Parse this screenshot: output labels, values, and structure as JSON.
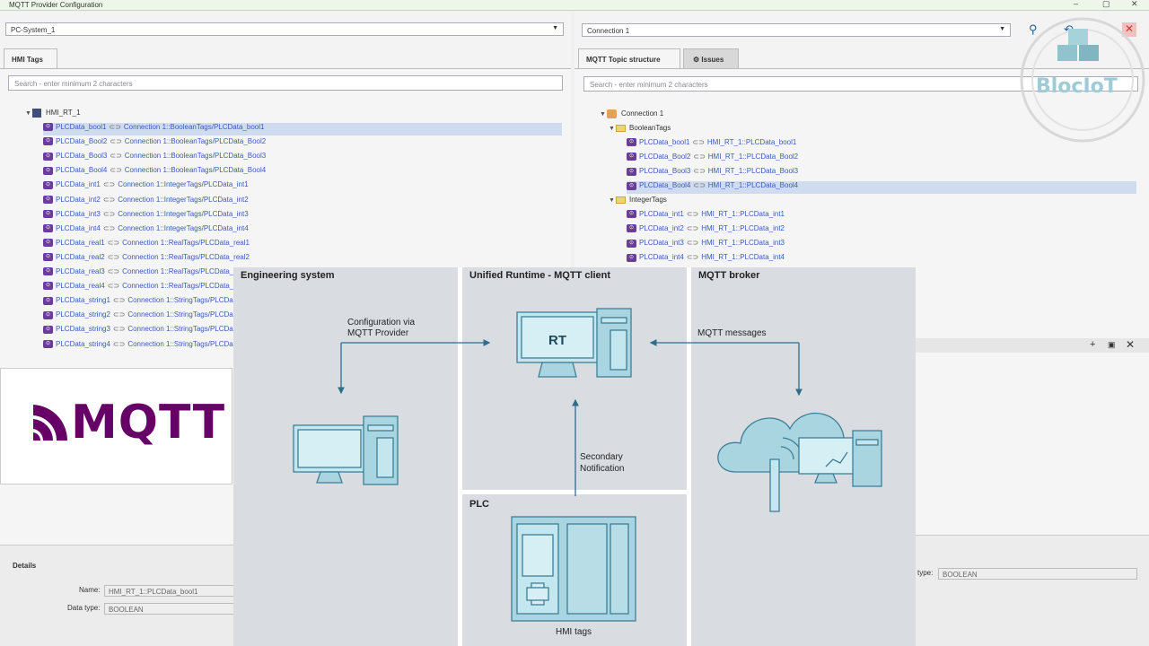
{
  "window": {
    "title": "MQTT Provider Configuration",
    "controls": [
      "–",
      "▢",
      "✕"
    ]
  },
  "left": {
    "system_select": "PC-System_1",
    "tab": "HMI Tags",
    "search_placeholder": "Search - enter minimum 2 characters",
    "root": "HMI_RT_1",
    "rows": [
      {
        "tag": "PLCData_bool1",
        "map": "Connection 1::BooleanTags/PLCData_bool1"
      },
      {
        "tag": "PLCData_Bool2",
        "map": "Connection 1::BooleanTags/PLCData_Bool2"
      },
      {
        "tag": "PLCData_Bool3",
        "map": "Connection 1::BooleanTags/PLCData_Bool3"
      },
      {
        "tag": "PLCData_Bool4",
        "map": "Connection 1::BooleanTags/PLCData_Bool4"
      },
      {
        "tag": "PLCData_int1",
        "map": "Connection 1::IntegerTags/PLCData_int1"
      },
      {
        "tag": "PLCData_int2",
        "map": "Connection 1::IntegerTags/PLCData_int2"
      },
      {
        "tag": "PLCData_int3",
        "map": "Connection 1::IntegerTags/PLCData_int3"
      },
      {
        "tag": "PLCData_int4",
        "map": "Connection 1::IntegerTags/PLCData_int4"
      },
      {
        "tag": "PLCData_real1",
        "map": "Connection 1::RealTags/PLCData_real1"
      },
      {
        "tag": "PLCData_real2",
        "map": "Connection 1::RealTags/PLCData_real2"
      },
      {
        "tag": "PLCData_real3",
        "map": "Connection 1::RealTags/PLCData_re"
      },
      {
        "tag": "PLCData_real4",
        "map": "Connection 1::RealTags/PLCData_re"
      },
      {
        "tag": "PLCData_string1",
        "map": "Connection 1::StringTags/PLCDa"
      },
      {
        "tag": "PLCData_string2",
        "map": "Connection 1::StringTags/PLCDa"
      },
      {
        "tag": "PLCData_string3",
        "map": "Connection 1::StringTags/PLCDa"
      },
      {
        "tag": "PLCData_string4",
        "map": "Connection 1::StringTags/PLCDa"
      }
    ],
    "details": {
      "heading": "Details",
      "name_label": "Name:",
      "name_value": "HMI_RT_1::PLCData_bool1",
      "type_label": "Data type:",
      "type_value": "BOOLEAN"
    }
  },
  "right": {
    "connection_select": "Connection 1",
    "tab_active": "MQTT Topic structure",
    "tab_inactive": "Issues",
    "search_placeholder": "Search - enter minimum 2 characters",
    "root": "Connection 1",
    "folder_bool": "BooleanTags",
    "folder_int": "IntegerTags",
    "bool_rows": [
      {
        "tag": "PLCData_bool1",
        "map": "HMI_RT_1::PLCData_bool1"
      },
      {
        "tag": "PLCData_Bool2",
        "map": "HMI_RT_1::PLCData_Bool2"
      },
      {
        "tag": "PLCData_Bool3",
        "map": "HMI_RT_1::PLCData_Bool3"
      },
      {
        "tag": "PLCData_Bool4",
        "map": "HMI_RT_1::PLCData_Bool4"
      }
    ],
    "int_rows": [
      {
        "tag": "PLCData_int1",
        "map": "HMI_RT_1::PLCData_int1"
      },
      {
        "tag": "PLCData_int2",
        "map": "HMI_RT_1::PLCData_int2"
      },
      {
        "tag": "PLCData_int3",
        "map": "HMI_RT_1::PLCData_int3"
      },
      {
        "tag": "PLCData_int4",
        "map": "HMI_RT_1::PLCData_int4"
      }
    ],
    "details_type_label": "type:",
    "details_type_value": "BOOLEAN"
  },
  "logo": {
    "text": "MQTT",
    "color": "#660066"
  },
  "watermark": {
    "text": "BlocIoT"
  },
  "diagram": {
    "engineering_title": "Engineering system",
    "runtime_title": "Unified Runtime - MQTT client",
    "broker_title": "MQTT broker",
    "plc_title": "PLC",
    "config_label_1": "Configuration via",
    "config_label_2": "MQTT Provider",
    "messages_label": "MQTT messages",
    "secondary_1": "Secondary",
    "secondary_2": "Notification",
    "rt_label": "RT",
    "hmi_tags_label": "HMI tags"
  }
}
